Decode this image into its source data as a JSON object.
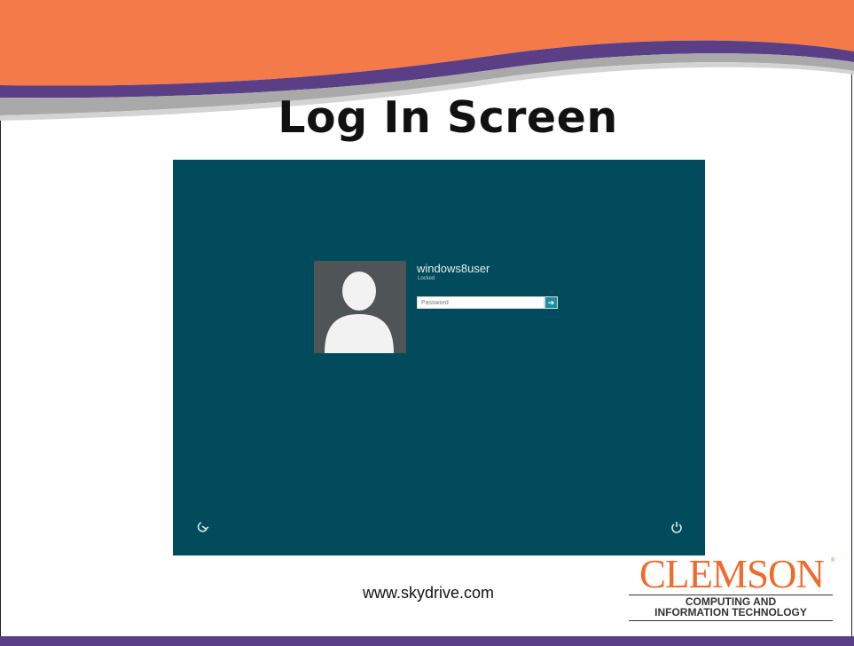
{
  "slide": {
    "title": "Log In Screen",
    "caption": "www.skydrive.com"
  },
  "login": {
    "username": "windows8user",
    "status": "Locked",
    "password_placeholder": "Password",
    "submit_glyph": "➔"
  },
  "logo": {
    "name": "CLEMSON",
    "registered": "®",
    "line1": "COMPUTING AND",
    "line2": "INFORMATION TECHNOLOGY"
  },
  "colors": {
    "header_orange": "#f47a4a",
    "header_purple": "#5a3f86",
    "lock_background": "#024b5c",
    "submit_button": "#1f8f9f",
    "logo_orange": "#f06a2c"
  },
  "icons": {
    "ease_of_access": "ease-of-access-icon",
    "power": "power-icon",
    "avatar": "user-silhouette"
  }
}
